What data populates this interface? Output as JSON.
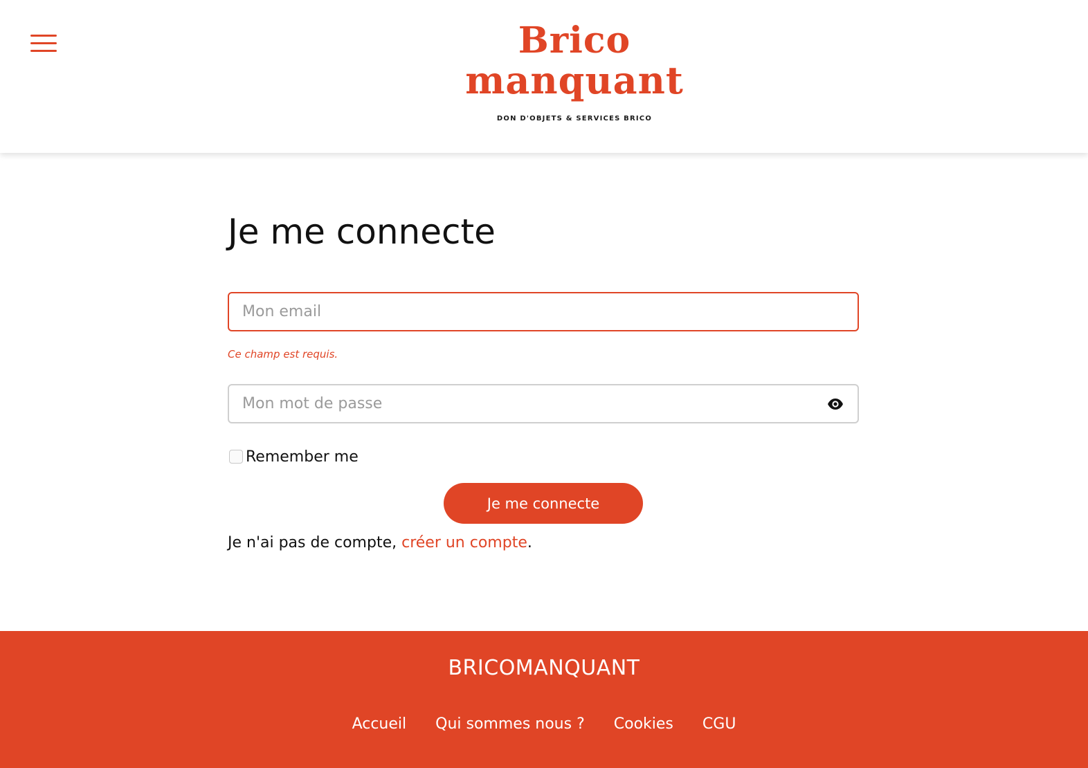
{
  "header": {
    "menu_icon": "hamburger-menu-icon",
    "logo": {
      "line1": "Brico",
      "line2": "manquant",
      "tagline": "DON D'OBJETS & SERVICES BRICO"
    }
  },
  "login": {
    "title": "Je me connecte",
    "email": {
      "placeholder": "Mon email",
      "value": "",
      "error": "Ce champ est requis."
    },
    "password": {
      "placeholder": "Mon mot de passe",
      "value": "",
      "toggle_icon": "eye-icon"
    },
    "remember": {
      "label": "Remember me",
      "checked": false
    },
    "submit_label": "Je me connecte",
    "signup": {
      "prefix": "Je n'ai pas de compte, ",
      "link_text": "créer un compte",
      "suffix": "."
    }
  },
  "footer": {
    "brand": "BRICOMANQUANT",
    "links": [
      {
        "label": "Accueil"
      },
      {
        "label": "Qui sommes nous ?"
      },
      {
        "label": "Cookies"
      },
      {
        "label": "CGU"
      }
    ]
  },
  "colors": {
    "accent": "#e04526",
    "text": "#111111",
    "placeholder": "#9a9a9a",
    "border": "#cfcfcf"
  }
}
